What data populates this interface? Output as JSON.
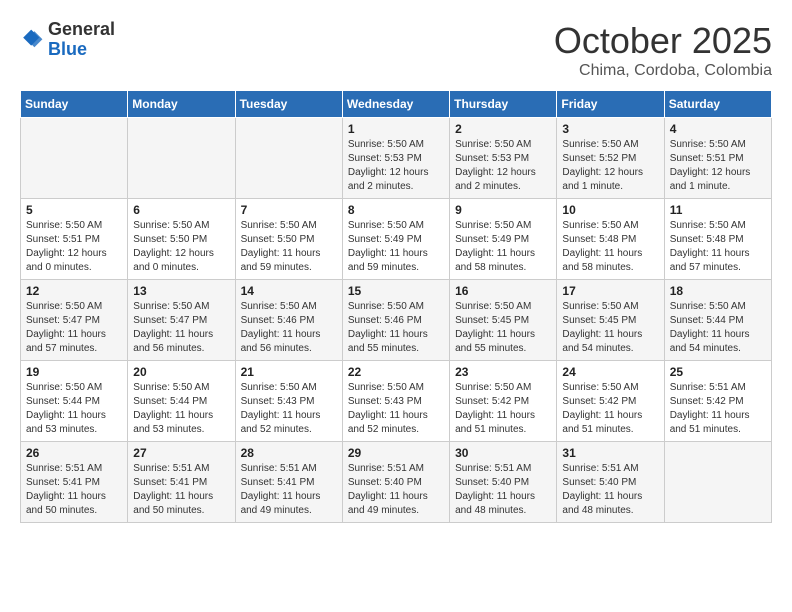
{
  "header": {
    "logo_general": "General",
    "logo_blue": "Blue",
    "month_title": "October 2025",
    "subtitle": "Chima, Cordoba, Colombia"
  },
  "weekdays": [
    "Sunday",
    "Monday",
    "Tuesday",
    "Wednesday",
    "Thursday",
    "Friday",
    "Saturday"
  ],
  "weeks": [
    [
      {
        "day": "",
        "info": ""
      },
      {
        "day": "",
        "info": ""
      },
      {
        "day": "",
        "info": ""
      },
      {
        "day": "1",
        "info": "Sunrise: 5:50 AM\nSunset: 5:53 PM\nDaylight: 12 hours\nand 2 minutes."
      },
      {
        "day": "2",
        "info": "Sunrise: 5:50 AM\nSunset: 5:53 PM\nDaylight: 12 hours\nand 2 minutes."
      },
      {
        "day": "3",
        "info": "Sunrise: 5:50 AM\nSunset: 5:52 PM\nDaylight: 12 hours\nand 1 minute."
      },
      {
        "day": "4",
        "info": "Sunrise: 5:50 AM\nSunset: 5:51 PM\nDaylight: 12 hours\nand 1 minute."
      }
    ],
    [
      {
        "day": "5",
        "info": "Sunrise: 5:50 AM\nSunset: 5:51 PM\nDaylight: 12 hours\nand 0 minutes."
      },
      {
        "day": "6",
        "info": "Sunrise: 5:50 AM\nSunset: 5:50 PM\nDaylight: 12 hours\nand 0 minutes."
      },
      {
        "day": "7",
        "info": "Sunrise: 5:50 AM\nSunset: 5:50 PM\nDaylight: 11 hours\nand 59 minutes."
      },
      {
        "day": "8",
        "info": "Sunrise: 5:50 AM\nSunset: 5:49 PM\nDaylight: 11 hours\nand 59 minutes."
      },
      {
        "day": "9",
        "info": "Sunrise: 5:50 AM\nSunset: 5:49 PM\nDaylight: 11 hours\nand 58 minutes."
      },
      {
        "day": "10",
        "info": "Sunrise: 5:50 AM\nSunset: 5:48 PM\nDaylight: 11 hours\nand 58 minutes."
      },
      {
        "day": "11",
        "info": "Sunrise: 5:50 AM\nSunset: 5:48 PM\nDaylight: 11 hours\nand 57 minutes."
      }
    ],
    [
      {
        "day": "12",
        "info": "Sunrise: 5:50 AM\nSunset: 5:47 PM\nDaylight: 11 hours\nand 57 minutes."
      },
      {
        "day": "13",
        "info": "Sunrise: 5:50 AM\nSunset: 5:47 PM\nDaylight: 11 hours\nand 56 minutes."
      },
      {
        "day": "14",
        "info": "Sunrise: 5:50 AM\nSunset: 5:46 PM\nDaylight: 11 hours\nand 56 minutes."
      },
      {
        "day": "15",
        "info": "Sunrise: 5:50 AM\nSunset: 5:46 PM\nDaylight: 11 hours\nand 55 minutes."
      },
      {
        "day": "16",
        "info": "Sunrise: 5:50 AM\nSunset: 5:45 PM\nDaylight: 11 hours\nand 55 minutes."
      },
      {
        "day": "17",
        "info": "Sunrise: 5:50 AM\nSunset: 5:45 PM\nDaylight: 11 hours\nand 54 minutes."
      },
      {
        "day": "18",
        "info": "Sunrise: 5:50 AM\nSunset: 5:44 PM\nDaylight: 11 hours\nand 54 minutes."
      }
    ],
    [
      {
        "day": "19",
        "info": "Sunrise: 5:50 AM\nSunset: 5:44 PM\nDaylight: 11 hours\nand 53 minutes."
      },
      {
        "day": "20",
        "info": "Sunrise: 5:50 AM\nSunset: 5:44 PM\nDaylight: 11 hours\nand 53 minutes."
      },
      {
        "day": "21",
        "info": "Sunrise: 5:50 AM\nSunset: 5:43 PM\nDaylight: 11 hours\nand 52 minutes."
      },
      {
        "day": "22",
        "info": "Sunrise: 5:50 AM\nSunset: 5:43 PM\nDaylight: 11 hours\nand 52 minutes."
      },
      {
        "day": "23",
        "info": "Sunrise: 5:50 AM\nSunset: 5:42 PM\nDaylight: 11 hours\nand 51 minutes."
      },
      {
        "day": "24",
        "info": "Sunrise: 5:50 AM\nSunset: 5:42 PM\nDaylight: 11 hours\nand 51 minutes."
      },
      {
        "day": "25",
        "info": "Sunrise: 5:51 AM\nSunset: 5:42 PM\nDaylight: 11 hours\nand 51 minutes."
      }
    ],
    [
      {
        "day": "26",
        "info": "Sunrise: 5:51 AM\nSunset: 5:41 PM\nDaylight: 11 hours\nand 50 minutes."
      },
      {
        "day": "27",
        "info": "Sunrise: 5:51 AM\nSunset: 5:41 PM\nDaylight: 11 hours\nand 50 minutes."
      },
      {
        "day": "28",
        "info": "Sunrise: 5:51 AM\nSunset: 5:41 PM\nDaylight: 11 hours\nand 49 minutes."
      },
      {
        "day": "29",
        "info": "Sunrise: 5:51 AM\nSunset: 5:40 PM\nDaylight: 11 hours\nand 49 minutes."
      },
      {
        "day": "30",
        "info": "Sunrise: 5:51 AM\nSunset: 5:40 PM\nDaylight: 11 hours\nand 48 minutes."
      },
      {
        "day": "31",
        "info": "Sunrise: 5:51 AM\nSunset: 5:40 PM\nDaylight: 11 hours\nand 48 minutes."
      },
      {
        "day": "",
        "info": ""
      }
    ]
  ]
}
